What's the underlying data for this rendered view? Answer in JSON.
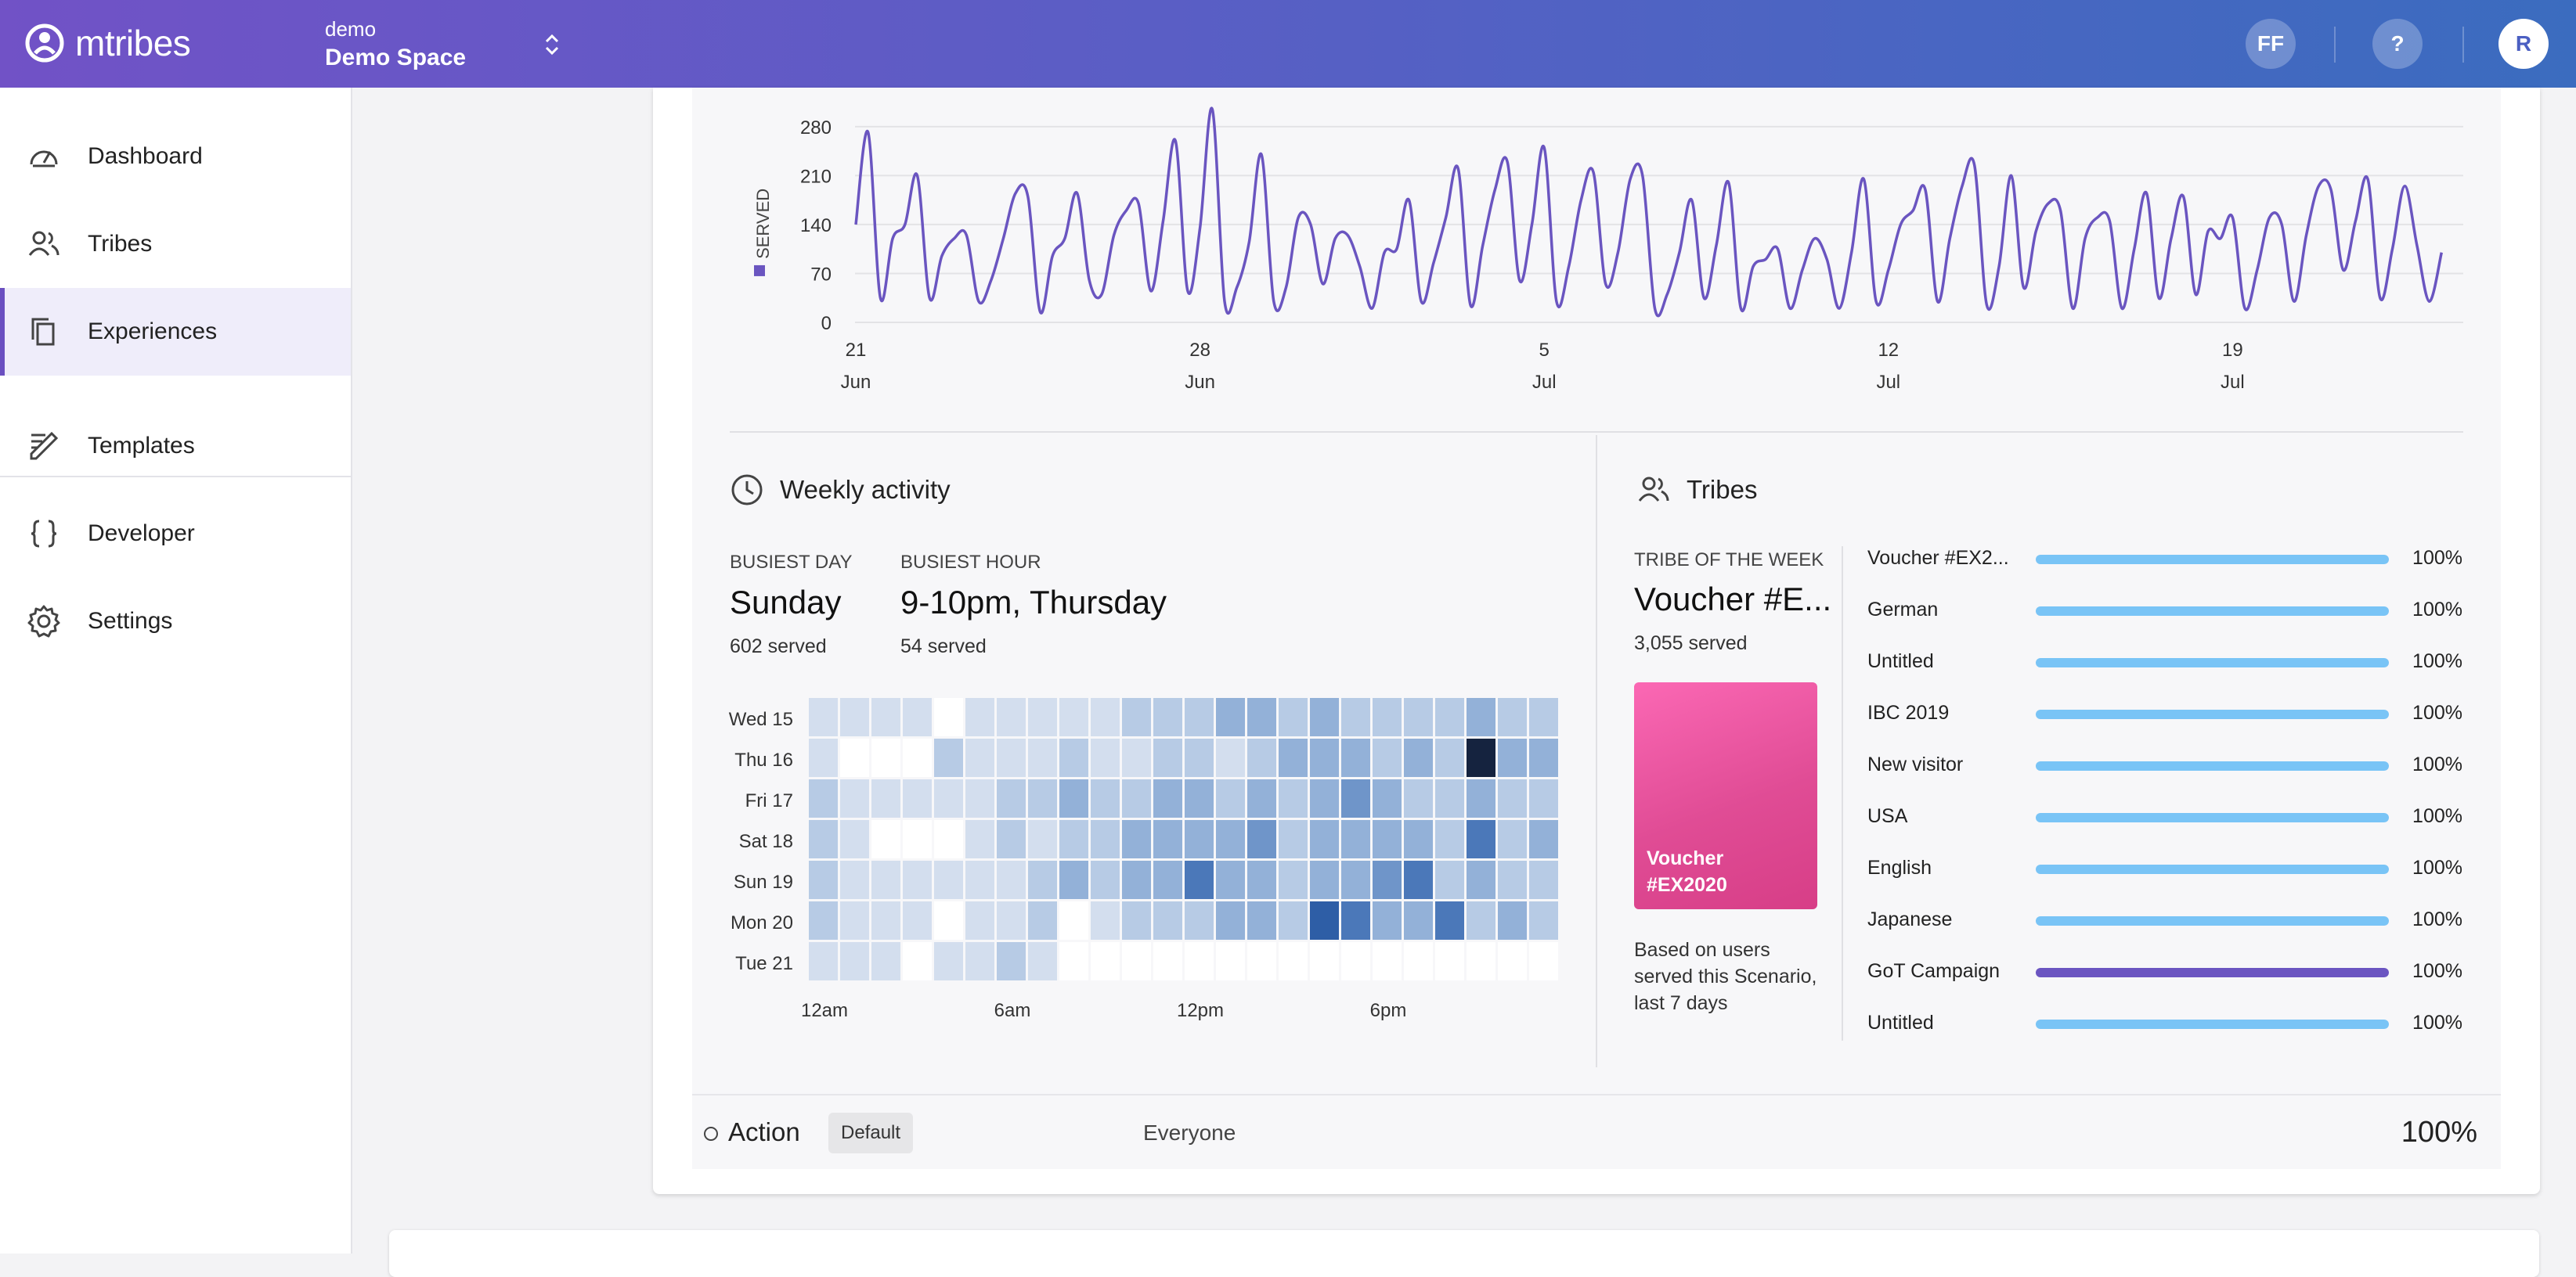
{
  "app": {
    "brand": "mtribes",
    "space_org": "demo",
    "space_name": "Demo Space",
    "header_avatars": [
      "FF",
      "?",
      "R"
    ]
  },
  "sidebar": {
    "items": [
      {
        "label": "Dashboard",
        "icon": "gauge-icon",
        "active": false
      },
      {
        "label": "Tribes",
        "icon": "users-icon",
        "active": false
      },
      {
        "label": "Experiences",
        "icon": "copy-icon",
        "active": true
      },
      {
        "label": "Templates",
        "icon": "edit-icon",
        "active": false
      },
      {
        "label": "Developer",
        "icon": "braces-icon",
        "active": false
      },
      {
        "label": "Settings",
        "icon": "gear-icon",
        "active": false
      }
    ]
  },
  "chart_data": {
    "type": "line",
    "ylabel": "SERVED",
    "ylim": [
      0,
      300
    ],
    "y_ticks": [
      "280",
      "210",
      "140",
      "70",
      "0"
    ],
    "x_ticks": [
      {
        "day": "21",
        "month": "Jun"
      },
      {
        "day": "28",
        "month": "Jun"
      },
      {
        "day": "5",
        "month": "Jul"
      },
      {
        "day": "12",
        "month": "Jul"
      },
      {
        "day": "19",
        "month": "Jul"
      }
    ],
    "x_start": "2020-06-21",
    "samples_per_day": 4,
    "color": "#6a55c0",
    "values": [
      140,
      272,
      35,
      120,
      140,
      210,
      35,
      95,
      120,
      125,
      30,
      60,
      120,
      185,
      180,
      15,
      95,
      120,
      185,
      60,
      40,
      125,
      160,
      170,
      45,
      145,
      260,
      45,
      135,
      305,
      30,
      50,
      115,
      240,
      30,
      50,
      150,
      140,
      55,
      120,
      125,
      80,
      20,
      100,
      105,
      175,
      30,
      85,
      150,
      220,
      25,
      110,
      190,
      230,
      60,
      140,
      250,
      30,
      80,
      175,
      215,
      55,
      100,
      205,
      210,
      20,
      40,
      100,
      175,
      35,
      110,
      200,
      20,
      80,
      90,
      105,
      20,
      75,
      120,
      90,
      20,
      100,
      205,
      30,
      75,
      140,
      160,
      190,
      30,
      120,
      195,
      225,
      25,
      80,
      210,
      50,
      130,
      170,
      160,
      20,
      120,
      150,
      145,
      20,
      105,
      185,
      35,
      120,
      180,
      40,
      130,
      120,
      150,
      20,
      75,
      150,
      140,
      30,
      125,
      195,
      190,
      75,
      145,
      205,
      35,
      105,
      195,
      110,
      30,
      100
    ]
  },
  "weekly_activity": {
    "title": "Weekly activity",
    "busiest_day_label": "BUSIEST DAY",
    "busiest_day": "Sunday",
    "busiest_day_served": "602 served",
    "busiest_hour_label": "BUSIEST HOUR",
    "busiest_hour": "9-10pm, Thursday",
    "busiest_hour_served": "54 served",
    "days": [
      "Wed 15",
      "Thu 16",
      "Fri 17",
      "Sat 18",
      "Sun 19",
      "Mon 20",
      "Tue 21"
    ],
    "hour_labels": [
      "12am",
      "6am",
      "12pm",
      "6pm"
    ],
    "heatmap": [
      [
        2,
        2,
        2,
        2,
        0,
        2,
        2,
        2,
        2,
        2,
        3,
        3,
        3,
        4,
        4,
        3,
        4,
        3,
        3,
        3,
        3,
        4,
        3,
        3
      ],
      [
        2,
        0,
        0,
        0,
        3,
        2,
        2,
        2,
        3,
        2,
        2,
        3,
        3,
        2,
        3,
        4,
        4,
        4,
        3,
        4,
        3,
        9,
        4,
        4
      ],
      [
        3,
        2,
        2,
        2,
        2,
        2,
        3,
        3,
        4,
        3,
        3,
        4,
        4,
        3,
        4,
        3,
        4,
        5,
        4,
        3,
        3,
        4,
        3,
        3
      ],
      [
        3,
        2,
        0,
        0,
        0,
        2,
        3,
        2,
        3,
        3,
        4,
        4,
        4,
        4,
        5,
        3,
        4,
        4,
        4,
        4,
        3,
        6,
        3,
        4
      ],
      [
        3,
        2,
        2,
        2,
        2,
        2,
        2,
        3,
        4,
        3,
        4,
        4,
        6,
        4,
        4,
        3,
        4,
        4,
        5,
        6,
        3,
        4,
        3,
        3
      ],
      [
        3,
        2,
        2,
        2,
        0,
        2,
        2,
        3,
        0,
        2,
        3,
        3,
        3,
        4,
        4,
        3,
        7,
        6,
        4,
        4,
        6,
        3,
        4,
        3
      ],
      [
        2,
        2,
        2,
        0,
        2,
        2,
        3,
        2,
        0,
        0,
        0,
        0,
        0,
        0,
        0,
        0,
        0,
        0,
        0,
        0,
        0,
        0,
        0,
        0
      ]
    ]
  },
  "tribes": {
    "title": "Tribes",
    "tribe_of_week_label": "TRIBE OF THE WEEK",
    "tribe_of_week_name": "Voucher #E...",
    "tribe_of_week_served": "3,055 served",
    "card_label_line1": "Voucher",
    "card_label_line2": "#EX2020",
    "note": "Based on users served this Scenario, last 7 days",
    "list": [
      {
        "name": "Voucher #EX2...",
        "pct": "100%",
        "color": "#79c4f6"
      },
      {
        "name": "German",
        "pct": "100%",
        "color": "#79c4f6"
      },
      {
        "name": "Untitled",
        "pct": "100%",
        "color": "#79c4f6"
      },
      {
        "name": "IBC 2019",
        "pct": "100%",
        "color": "#79c4f6"
      },
      {
        "name": "New visitor",
        "pct": "100%",
        "color": "#79c4f6"
      },
      {
        "name": "USA",
        "pct": "100%",
        "color": "#79c4f6"
      },
      {
        "name": "English",
        "pct": "100%",
        "color": "#79c4f6"
      },
      {
        "name": "Japanese",
        "pct": "100%",
        "color": "#79c4f6"
      },
      {
        "name": "GoT Campaign",
        "pct": "100%",
        "color": "#6b55c1"
      },
      {
        "name": "Untitled",
        "pct": "100%",
        "color": "#79c4f6"
      }
    ]
  },
  "action": {
    "label": "Action",
    "badge": "Default",
    "audience": "Everyone",
    "pct": "100%"
  }
}
